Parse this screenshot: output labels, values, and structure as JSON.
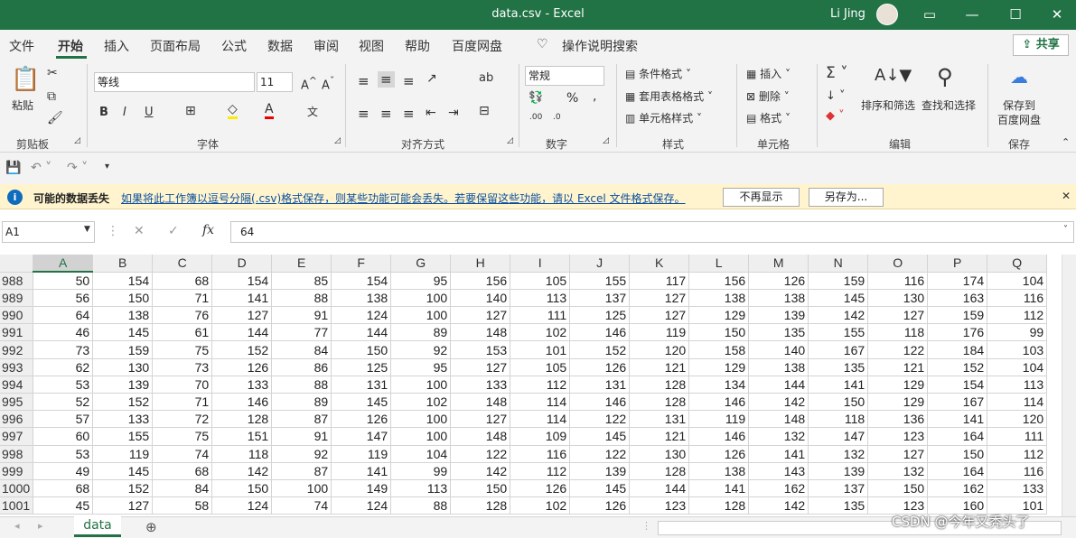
{
  "titlebar": {
    "title": "data.csv  -  Excel",
    "user": "Li Jing"
  },
  "tabs": [
    "文件",
    "开始",
    "插入",
    "页面布局",
    "公式",
    "数据",
    "审阅",
    "视图",
    "帮助",
    "百度网盘"
  ],
  "tell_me": "操作说明搜索",
  "share": "共享",
  "ribbon": {
    "paste": "粘贴",
    "font_name": "等线",
    "font_size": "11",
    "number_format": "常规",
    "cond_format": "条件格式",
    "table_format": "套用表格格式",
    "cell_style": "单元格样式",
    "insert": "插入",
    "delete": "删除",
    "format": "格式",
    "sort_filter": "排序和筛选",
    "find_select": "查找和选择",
    "save_baidu_1": "保存到",
    "save_baidu_2": "百度网盘",
    "groups": {
      "clipboard": "剪贴板",
      "font": "字体",
      "align": "对齐方式",
      "number": "数字",
      "styles": "样式",
      "cells": "单元格",
      "edit": "编辑",
      "save": "保存"
    }
  },
  "message": {
    "title": "可能的数据丢失",
    "text": "如果将此工作簿以逗号分隔(.csv)格式保存，则某些功能可能会丢失。若要保留这些功能，请以 Excel 文件格式保存。",
    "btn1": "不再显示",
    "btn2": "另存为..."
  },
  "formula_bar": {
    "name_box": "A1",
    "fx": "fx",
    "value": "64"
  },
  "columns": [
    "A",
    "B",
    "C",
    "D",
    "E",
    "F",
    "G",
    "H",
    "I",
    "J",
    "K",
    "L",
    "M",
    "N",
    "O",
    "P",
    "Q"
  ],
  "rows": [
    {
      "n": "988",
      "v": [
        50,
        154,
        68,
        154,
        85,
        154,
        95,
        156,
        105,
        155,
        117,
        156,
        126,
        159,
        116,
        174,
        104
      ]
    },
    {
      "n": "989",
      "v": [
        56,
        150,
        71,
        141,
        88,
        138,
        100,
        140,
        113,
        137,
        127,
        138,
        138,
        145,
        130,
        163,
        116
      ]
    },
    {
      "n": "990",
      "v": [
        64,
        138,
        76,
        127,
        91,
        124,
        100,
        127,
        111,
        125,
        127,
        129,
        139,
        142,
        127,
        159,
        112
      ]
    },
    {
      "n": "991",
      "v": [
        46,
        145,
        61,
        144,
        77,
        144,
        89,
        148,
        102,
        146,
        119,
        150,
        135,
        155,
        118,
        176,
        99
      ]
    },
    {
      "n": "992",
      "v": [
        73,
        159,
        75,
        152,
        84,
        150,
        92,
        153,
        101,
        152,
        120,
        158,
        140,
        167,
        122,
        184,
        103
      ]
    },
    {
      "n": "993",
      "v": [
        62,
        130,
        73,
        126,
        86,
        125,
        95,
        127,
        105,
        126,
        121,
        129,
        138,
        135,
        121,
        152,
        104
      ]
    },
    {
      "n": "994",
      "v": [
        53,
        139,
        70,
        133,
        88,
        131,
        100,
        133,
        112,
        131,
        128,
        134,
        144,
        141,
        129,
        154,
        113
      ]
    },
    {
      "n": "995",
      "v": [
        52,
        152,
        71,
        146,
        89,
        145,
        102,
        148,
        114,
        146,
        128,
        146,
        142,
        150,
        129,
        167,
        114
      ]
    },
    {
      "n": "996",
      "v": [
        57,
        133,
        72,
        128,
        87,
        126,
        100,
        127,
        114,
        122,
        131,
        119,
        148,
        118,
        136,
        141,
        120
      ]
    },
    {
      "n": "997",
      "v": [
        60,
        155,
        75,
        151,
        91,
        147,
        100,
        148,
        109,
        145,
        121,
        146,
        132,
        147,
        123,
        164,
        111
      ]
    },
    {
      "n": "998",
      "v": [
        53,
        119,
        74,
        118,
        92,
        119,
        104,
        122,
        116,
        122,
        130,
        126,
        141,
        132,
        127,
        150,
        112
      ]
    },
    {
      "n": "999",
      "v": [
        49,
        145,
        68,
        142,
        87,
        141,
        99,
        142,
        112,
        139,
        128,
        138,
        143,
        139,
        132,
        164,
        116
      ]
    },
    {
      "n": "1000",
      "v": [
        68,
        152,
        84,
        150,
        100,
        149,
        113,
        150,
        126,
        145,
        144,
        141,
        162,
        137,
        150,
        162,
        133
      ]
    },
    {
      "n": "1001",
      "v": [
        45,
        127,
        58,
        124,
        74,
        124,
        88,
        128,
        102,
        126,
        123,
        128,
        142,
        135,
        123,
        160,
        101
      ]
    }
  ],
  "sheet_tab": "data",
  "watermark": "CSDN @今年又秃头了"
}
